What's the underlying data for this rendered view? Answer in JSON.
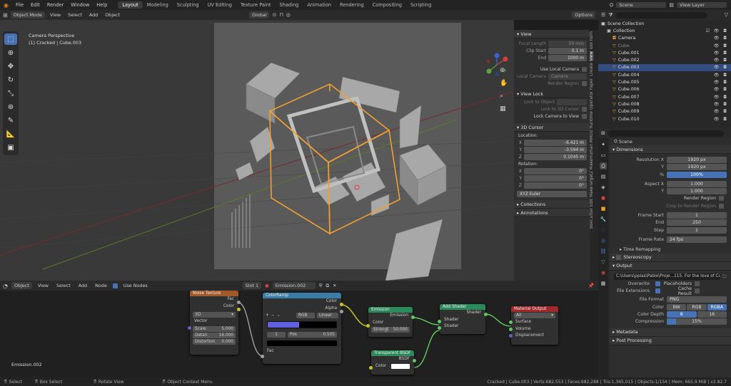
{
  "topbar": {
    "menus": [
      "File",
      "Edit",
      "Render",
      "Window",
      "Help"
    ],
    "workspaces": [
      "Layout",
      "Modeling",
      "Sculpting",
      "UV Editing",
      "Texture Paint",
      "Shading",
      "Animation",
      "Rendering",
      "Compositing",
      "Scripting"
    ],
    "active_workspace": "Layout",
    "scene": "Scene",
    "view_layer": "View Layer"
  },
  "vp_header": {
    "mode": "Object Mode",
    "menus": [
      "View",
      "Select",
      "Add",
      "Object"
    ],
    "transform": "Global",
    "options": "Options"
  },
  "viewport": {
    "overlay_line1": "Camera Perspective",
    "overlay_line2": "(1) Cracked | Cube.003"
  },
  "npanel": {
    "view_title": "View",
    "focal_label": "Focal Length",
    "focal_value": "50 mm",
    "clip_start_label": "Clip Start",
    "clip_start_value": "0.1 m",
    "end_label": "End",
    "end_value": "1000 m",
    "use_local_camera": "Use Local Camera",
    "local_camera_label": "Local Camera",
    "local_camera_value": "Camera",
    "render_region": "Render Region",
    "view_lock_title": "View Lock",
    "lock_object": "Lock to Object",
    "lock_3d_cursor": "Lock to 3D Cursor",
    "lock_camera": "Lock Camera to View",
    "cursor_title": "3D Cursor",
    "location_label": "Location:",
    "loc_x": "-6.421 m",
    "loc_y": "-3.594 m",
    "loc_z": "0.1045 m",
    "rotation_label": "Rotation:",
    "rot_x": "0°",
    "rot_y": "0°",
    "rot_z": "0°",
    "rot_mode": "XYZ Euler",
    "collections": "Collections",
    "annotations": "Annotations",
    "tabs": [
      "Item",
      "Tool",
      "View",
      "Create",
      "Paper",
      "Operator",
      "MMD2 Runtime",
      "MakeHuman",
      "MakeTarget2",
      "Edit",
      "BoxCutter"
    ]
  },
  "outliner": {
    "scene_collection": "Scene Collection",
    "rows": [
      {
        "name": "Collection",
        "sel": false,
        "indent": 1
      },
      {
        "name": "Camera",
        "sel": false,
        "indent": 2
      },
      {
        "name": "Cube",
        "sel": false,
        "indent": 2
      },
      {
        "name": "Cube.001",
        "sel": false,
        "indent": 2
      },
      {
        "name": "Cube.002",
        "sel": false,
        "indent": 2
      },
      {
        "name": "Cube.003",
        "sel": true,
        "indent": 2
      },
      {
        "name": "Cube.004",
        "sel": false,
        "indent": 2
      },
      {
        "name": "Cube.005",
        "sel": false,
        "indent": 2
      },
      {
        "name": "Cube.006",
        "sel": false,
        "indent": 2
      },
      {
        "name": "Cube.007",
        "sel": false,
        "indent": 2
      },
      {
        "name": "Cube.008",
        "sel": false,
        "indent": 2
      },
      {
        "name": "Cube.009",
        "sel": false,
        "indent": 2
      },
      {
        "name": "Cube.010",
        "sel": false,
        "indent": 2
      }
    ]
  },
  "props": {
    "scene": "Scene",
    "dimensions": "Dimensions",
    "res_x_label": "Resolution X",
    "res_x": "1920 px",
    "res_y_label": "Y",
    "res_y": "1920 px",
    "pct_label": "%",
    "pct": "100%",
    "aspect_x_label": "Aspect X",
    "aspect_x": "1.000",
    "aspect_y_label": "Y",
    "aspect_y": "1.000",
    "render_region": "Render Region",
    "crop": "Crop to Render Region",
    "frame_start_label": "Frame Start",
    "frame_start": "1",
    "end_label": "End",
    "end": "250",
    "step_label": "Step",
    "step": "1",
    "frame_rate_label": "Frame Rate",
    "frame_rate": "24 fps",
    "time_remapping": "Time Remapping",
    "stereoscopy": "Stereoscopy",
    "output": "Output",
    "output_path": "C:\\Users\\pplas\\Pablo\\Proje...115. For the love of Cubes",
    "overwrite": "Overwrite",
    "placeholders": "Placeholders",
    "file_ext": "File Extensions",
    "cache_result": "Cache Result",
    "file_format_label": "File Format",
    "file_format": "PNG",
    "color_label": "Color",
    "color_opts": [
      "BW",
      "RGB",
      "RGBA"
    ],
    "depth_label": "Color Depth",
    "depth_opts": [
      "8",
      "16"
    ],
    "compression_label": "Compression",
    "compression": "15%",
    "metadata": "Metadata",
    "post_processing": "Post Processing"
  },
  "node_header": {
    "type": "Object",
    "menus": [
      "View",
      "Select",
      "Add",
      "Node"
    ],
    "use_nodes": "Use Nodes",
    "slot": "Slot 1",
    "material": "Emission.002",
    "label": "Emission.002"
  },
  "nodes": {
    "noise": {
      "title": "Noise Texture",
      "fac": "Fac",
      "color": "Color",
      "dim": "3D",
      "vector": "Vector",
      "scale_l": "Scale",
      "scale_v": "5.000",
      "detail_l": "Detail",
      "detail_v": "16.000",
      "distortion_l": "Distortion",
      "distortion_v": "0.000"
    },
    "ramp": {
      "title": "ColorRamp",
      "color": "Color",
      "alpha": "Alpha",
      "mode": "RGB",
      "interp": "Linear",
      "index": "1",
      "pos_l": "Pos",
      "pos_v": "0.505",
      "fac": "Fac"
    },
    "emission": {
      "title": "Emission",
      "out": "Emission",
      "color": "Color",
      "strength_l": "Strengt",
      "strength_v": "50.000"
    },
    "add_shader": {
      "title": "Add Shader",
      "out": "Shader",
      "in1": "Shader",
      "in2": "Shader"
    },
    "transparent": {
      "title": "Transparent BSDF",
      "out": "BSDF",
      "color": "Color"
    },
    "output": {
      "title": "Material Output",
      "target": "All",
      "surface": "Surface",
      "volume": "Volume",
      "displacement": "Displacement"
    }
  },
  "statusbar": {
    "select": "Select",
    "box_select": "Box Select",
    "rotate": "Rotate View",
    "context": "Object Context Menu",
    "stats": "Cracked | Cube.003 | Verts:682,553 | Faces:682,288 | Tris:1,365,015 | Objects:1/154 | Mem: 665.9 MiB | v2.82.7"
  },
  "colors": {
    "accent": "#4772b3",
    "selected_row": "#334d80",
    "orange": "#f0a030"
  }
}
